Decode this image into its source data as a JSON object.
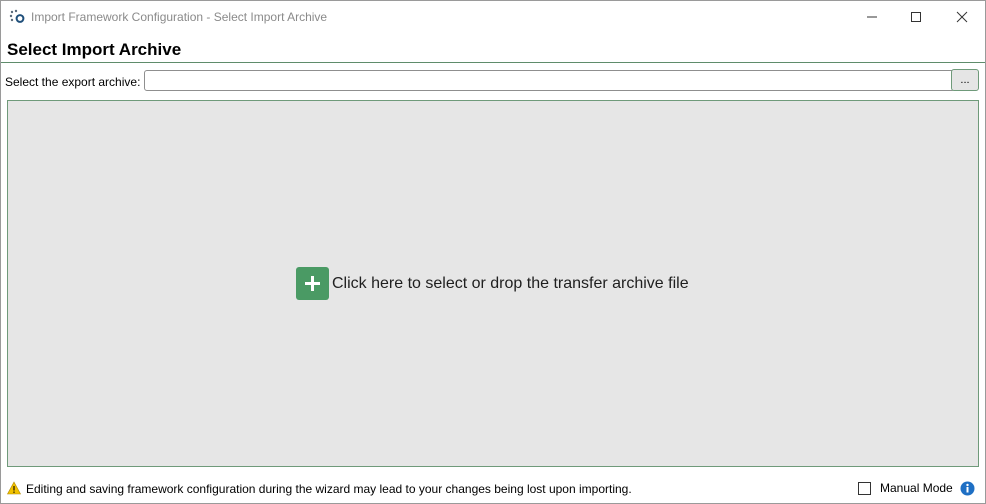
{
  "window": {
    "title": "Import Framework Configuration - Select Import Archive",
    "controls": {
      "minimize_icon": "minimize-icon",
      "maximize_icon": "maximize-icon",
      "close_icon": "close-icon"
    }
  },
  "header": {
    "title": "Select Import Archive"
  },
  "archive": {
    "label": "Select the export archive:",
    "value": "",
    "placeholder": "",
    "browse_label": "..."
  },
  "drop_zone": {
    "icon": "plus-icon",
    "text": "Click here to select or drop the transfer archive file"
  },
  "footer": {
    "warning_icon": "warning-icon",
    "warning_text": "Editing and saving framework configuration during the wizard may lead to your changes being lost upon importing.",
    "manual_mode_label": "Manual Mode",
    "manual_mode_checked": false,
    "info_icon": "info-icon"
  },
  "colors": {
    "accent_green": "#4a9a64",
    "border_green": "#6f9a7a",
    "drop_zone_bg": "#e6e6e6",
    "info_blue": "#1e6fc4",
    "warning_yellow": "#f2c200"
  }
}
